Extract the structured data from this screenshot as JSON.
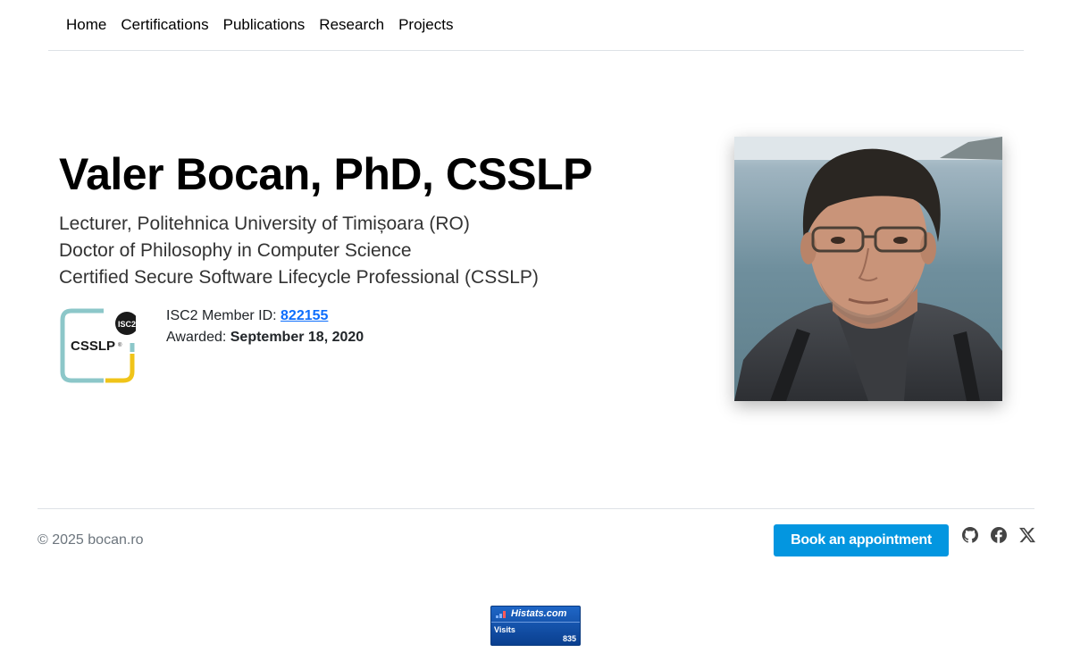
{
  "nav": {
    "items": [
      {
        "label": "Home"
      },
      {
        "label": "Certifications"
      },
      {
        "label": "Publications"
      },
      {
        "label": "Research"
      },
      {
        "label": "Projects"
      }
    ]
  },
  "hero": {
    "title": "Valer Bocan, PhD, CSSLP",
    "lines": [
      "Lecturer, Politehnica University of Timișoara (RO)",
      "Doctor of Philosophy in Computer Science",
      "Certified Secure Software Lifecycle Professional (CSSLP)"
    ]
  },
  "badge": {
    "logo_text": "CSSLP",
    "logo_registered": "®",
    "org_text": "ISC2",
    "member_label": "ISC2 Member ID: ",
    "member_id": "822155",
    "awarded_label": "Awarded: ",
    "awarded_date": "September 18, 2020",
    "colors": {
      "teal": "#8cc7c9",
      "yellow": "#f0c419",
      "dark": "#1a1a1a"
    }
  },
  "photo": {
    "icon": "portrait-photo"
  },
  "footer": {
    "copyright": "© 2025 bocan.ro",
    "book_label": "Book an appointment",
    "book_color": "#0396e0",
    "social": [
      {
        "icon": "github-icon"
      },
      {
        "icon": "facebook-icon"
      },
      {
        "icon": "x-icon"
      }
    ]
  },
  "counter": {
    "brand": "Histats.com",
    "label": "Visits",
    "value": "835"
  }
}
